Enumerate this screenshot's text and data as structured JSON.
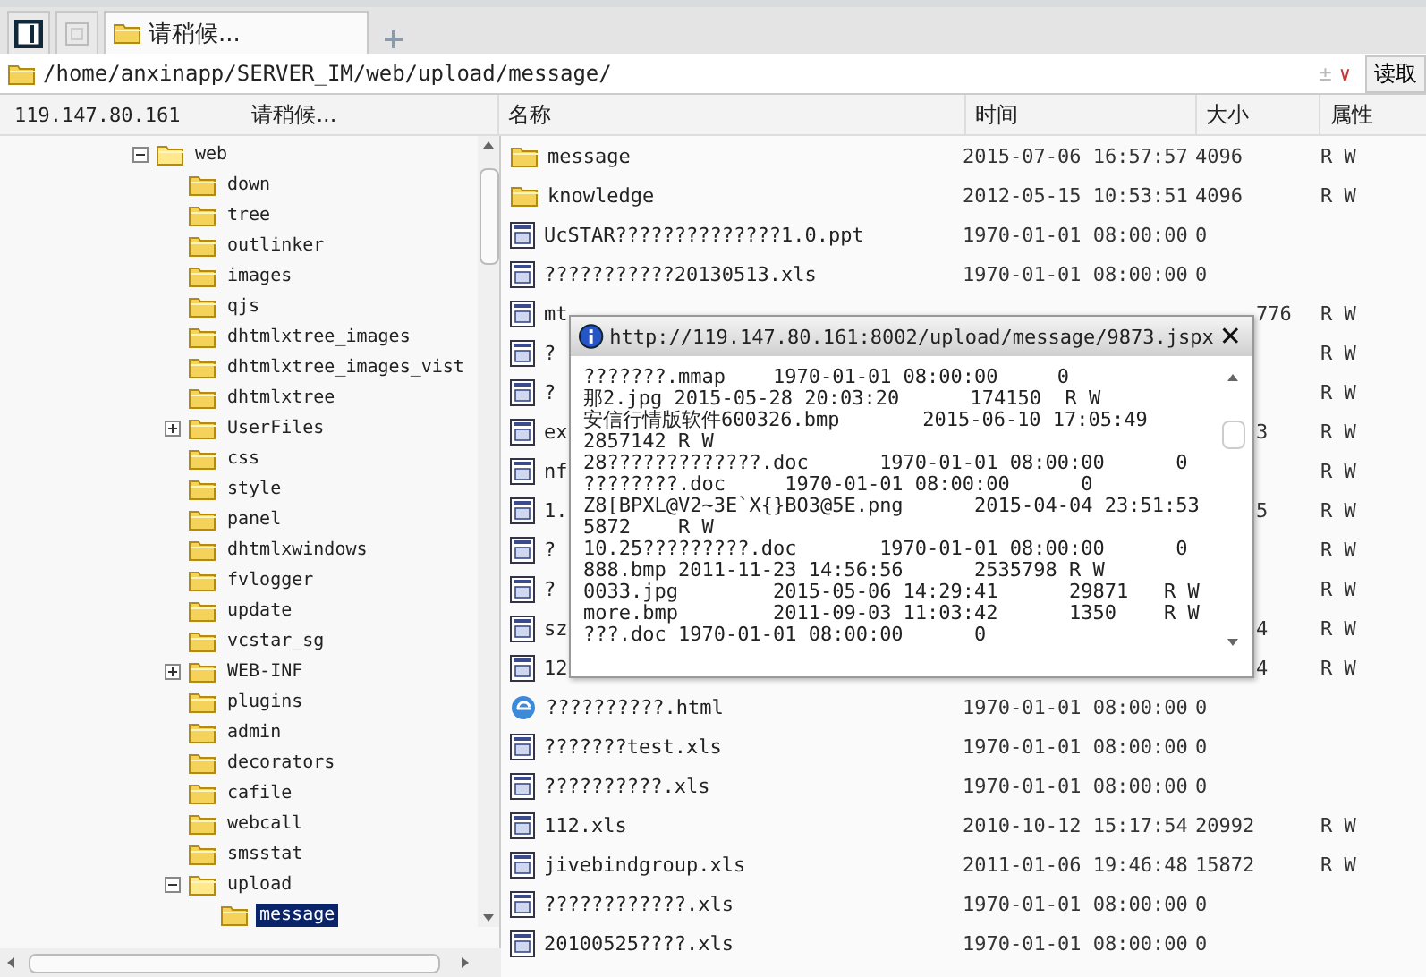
{
  "tabs": [
    {
      "kind": "panel",
      "selected": false
    },
    {
      "kind": "blank",
      "selected": false
    },
    {
      "kind": "folder",
      "label": "请稍候...",
      "selected": true
    }
  ],
  "address": {
    "path": "/home/anxinapp/SERVER_IM/web/upload/message/",
    "plus": "±",
    "caret": "∨",
    "button": "读取"
  },
  "left_header": {
    "host": "119.147.80.161",
    "status": "请稍候..."
  },
  "columns": [
    "名称",
    "时间",
    "大小",
    "属性"
  ],
  "tree": [
    {
      "label": "web",
      "expanded": true,
      "selected": false,
      "children": [
        {
          "label": "down",
          "selected": false
        },
        {
          "label": "tree",
          "selected": false
        },
        {
          "label": "outlinker",
          "selected": false
        },
        {
          "label": "images",
          "selected": false
        },
        {
          "label": "qjs",
          "selected": false
        },
        {
          "label": "dhtmlxtree_images",
          "selected": false
        },
        {
          "label": "dhtmlxtree_images_vist",
          "selected": false
        },
        {
          "label": "dhtmlxtree",
          "selected": false
        },
        {
          "label": "UserFiles",
          "expanded": false,
          "selected": false
        },
        {
          "label": "css",
          "selected": false
        },
        {
          "label": "style",
          "selected": false
        },
        {
          "label": "panel",
          "selected": false
        },
        {
          "label": "dhtmlxwindows",
          "selected": false
        },
        {
          "label": "fvlogger",
          "selected": false
        },
        {
          "label": "update",
          "selected": false
        },
        {
          "label": "vcstar_sg",
          "selected": false
        },
        {
          "label": "WEB-INF",
          "expanded": false,
          "selected": false
        },
        {
          "label": "plugins",
          "selected": false
        },
        {
          "label": "admin",
          "selected": false
        },
        {
          "label": "decorators",
          "selected": false
        },
        {
          "label": "cafile",
          "selected": false
        },
        {
          "label": "webcall",
          "selected": false
        },
        {
          "label": "smsstat",
          "selected": false
        },
        {
          "label": "upload",
          "expanded": true,
          "selected": false,
          "children": [
            {
              "label": "message",
              "selected": true
            }
          ]
        }
      ]
    }
  ],
  "rows": [
    {
      "kind": "folder",
      "name": "message",
      "time": "2015-07-06 16:57:57",
      "size": "4096",
      "attr": "R W"
    },
    {
      "kind": "folder",
      "name": "knowledge",
      "time": "2012-05-15 10:53:51",
      "size": "4096",
      "attr": "R W"
    },
    {
      "kind": "file",
      "name": "UcSTAR??????????????1.0.ppt",
      "time": "1970-01-01 08:00:00",
      "size": "0"
    },
    {
      "kind": "file",
      "name": "???????????20130513.xls",
      "time": "1970-01-01 08:00:00",
      "size": "0"
    },
    {
      "kind": "file",
      "name": "mt",
      "size": "776",
      "attr": "R W"
    },
    {
      "kind": "file",
      "name": "?",
      "attr": "R W"
    },
    {
      "kind": "file",
      "name": "?",
      "attr": "R W"
    },
    {
      "kind": "file",
      "name": "ex",
      "size": "3",
      "attr": "R W"
    },
    {
      "kind": "file",
      "name": "nf",
      "attr": "R W"
    },
    {
      "kind": "file",
      "name": "1.",
      "size": "5",
      "attr": "R W"
    },
    {
      "kind": "file",
      "name": "?",
      "attr": "R W"
    },
    {
      "kind": "file",
      "name": "?",
      "attr": "R W"
    },
    {
      "kind": "file",
      "name": "sz",
      "size": "4",
      "attr": "R W"
    },
    {
      "kind": "file",
      "name": "12",
      "size": "4",
      "attr": "R W"
    },
    {
      "kind": "web",
      "name": "??????????.html",
      "time": "1970-01-01 08:00:00",
      "size": "0"
    },
    {
      "kind": "file",
      "name": "???????test.xls",
      "time": "1970-01-01 08:00:00",
      "size": "0"
    },
    {
      "kind": "file",
      "name": "??????????.xls",
      "time": "1970-01-01 08:00:00",
      "size": "0"
    },
    {
      "kind": "file",
      "name": "112.xls",
      "time": "2010-10-12 15:17:54",
      "size": "20992",
      "attr": "R W"
    },
    {
      "kind": "file",
      "name": "jivebindgroup.xls",
      "time": "2011-01-06 19:46:48",
      "size": "15872",
      "attr": "R W"
    },
    {
      "kind": "file",
      "name": "????????????.xls",
      "time": "1970-01-01 08:00:00",
      "size": "0"
    },
    {
      "kind": "file",
      "name": "20100525????.xls",
      "time": "1970-01-01 08:00:00",
      "size": "0"
    }
  ],
  "popup": {
    "title": "http://119.147.80.161:8002/upload/message/9873.jspx",
    "close": "✕",
    "lines": [
      "???????.mmap    1970-01-01 08:00:00     0",
      "那2.jpg 2015-05-28 20:03:20      174150  R W",
      "安信行情版软件600326.bmp       2015-06-10 17:05:49",
      "2857142 R W",
      "28?????????????.doc      1970-01-01 08:00:00      0",
      "????????.doc     1970-01-01 08:00:00      0",
      "Z8[BPXL@V2~3E`X{}BO3@5E.png      2015-04-04 23:51:53",
      "5872    R W",
      "10.25?????????.doc       1970-01-01 08:00:00      0",
      "888.bmp 2011-11-23 14:56:56      2535798 R W",
      "0033.jpg        2015-05-06 14:29:41      29871   R W",
      "more.bmp        2011-09-03 11:03:42      1350    R W",
      "???.doc 1970-01-01 08:00:00      0"
    ]
  }
}
